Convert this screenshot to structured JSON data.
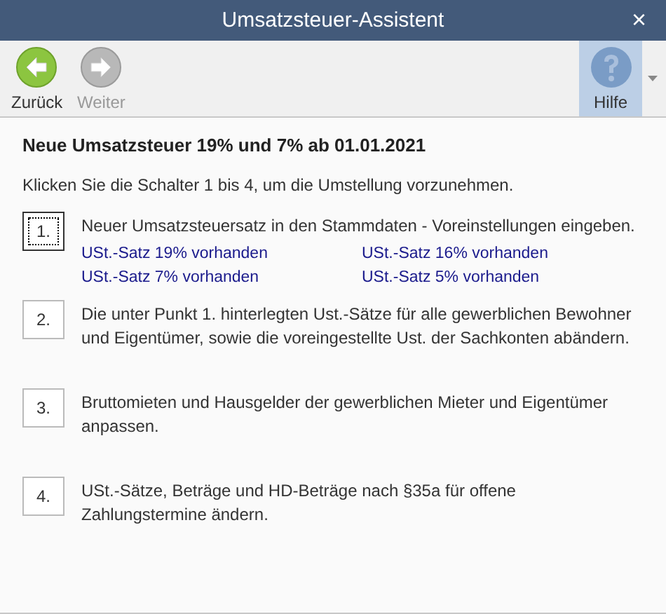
{
  "window": {
    "title": "Umsatzsteuer-Assistent",
    "close": "×"
  },
  "toolbar": [
    {
      "kind": "back",
      "label": "Zurück",
      "disabled": false,
      "highlighted": false
    },
    {
      "kind": "forward",
      "label": "Weiter",
      "disabled": true,
      "highlighted": false
    },
    {
      "kind": "help",
      "label": "Hilfe",
      "disabled": false,
      "highlighted": true
    }
  ],
  "heading": "Neue Umsatzsteuer 19% und 7% ab 01.01.2021",
  "intro": "Klicken Sie die Schalter 1 bis 4, um die Umstellung vorzunehmen.",
  "steps": [
    {
      "number": "1.",
      "focused": true,
      "text": "Neuer Umsatzsteuersatz in den Stammdaten - Voreinstellungen eingeben.",
      "statuses": [
        "USt.-Satz 19% vorhanden",
        "USt.-Satz 16% vorhanden",
        "USt.-Satz 7% vorhanden",
        "USt.-Satz 5% vorhanden"
      ]
    },
    {
      "number": "2.",
      "focused": false,
      "text": "Die unter Punkt 1. hinterlegten Ust.-Sätze für alle gewerblichen Bewohner und Eigentümer, sowie die voreingestellte Ust. der Sachkonten abändern."
    },
    {
      "number": "3.",
      "focused": false,
      "text": "Bruttomieten und Hausgelder der gewerblichen Mieter und Eigentümer anpassen."
    },
    {
      "number": "4.",
      "focused": false,
      "text": "USt.-Sätze, Beträge und HD-Beträge nach §35a für offene Zahlungstermine ändern."
    }
  ]
}
